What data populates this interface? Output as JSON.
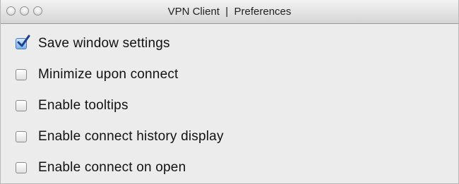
{
  "window": {
    "title": "VPN Client  |  Preferences",
    "controls": [
      "close-button",
      "minimize-button",
      "zoom-button"
    ]
  },
  "preferences": {
    "options": [
      {
        "label": "Save window settings",
        "checked": true
      },
      {
        "label": "Minimize upon connect",
        "checked": false
      },
      {
        "label": "Enable tooltips",
        "checked": false
      },
      {
        "label": "Enable connect history display",
        "checked": false
      },
      {
        "label": "Enable connect on open",
        "checked": false
      }
    ]
  },
  "colors": {
    "checkmark": "#1a3f8f",
    "window_background": "#ececec"
  }
}
